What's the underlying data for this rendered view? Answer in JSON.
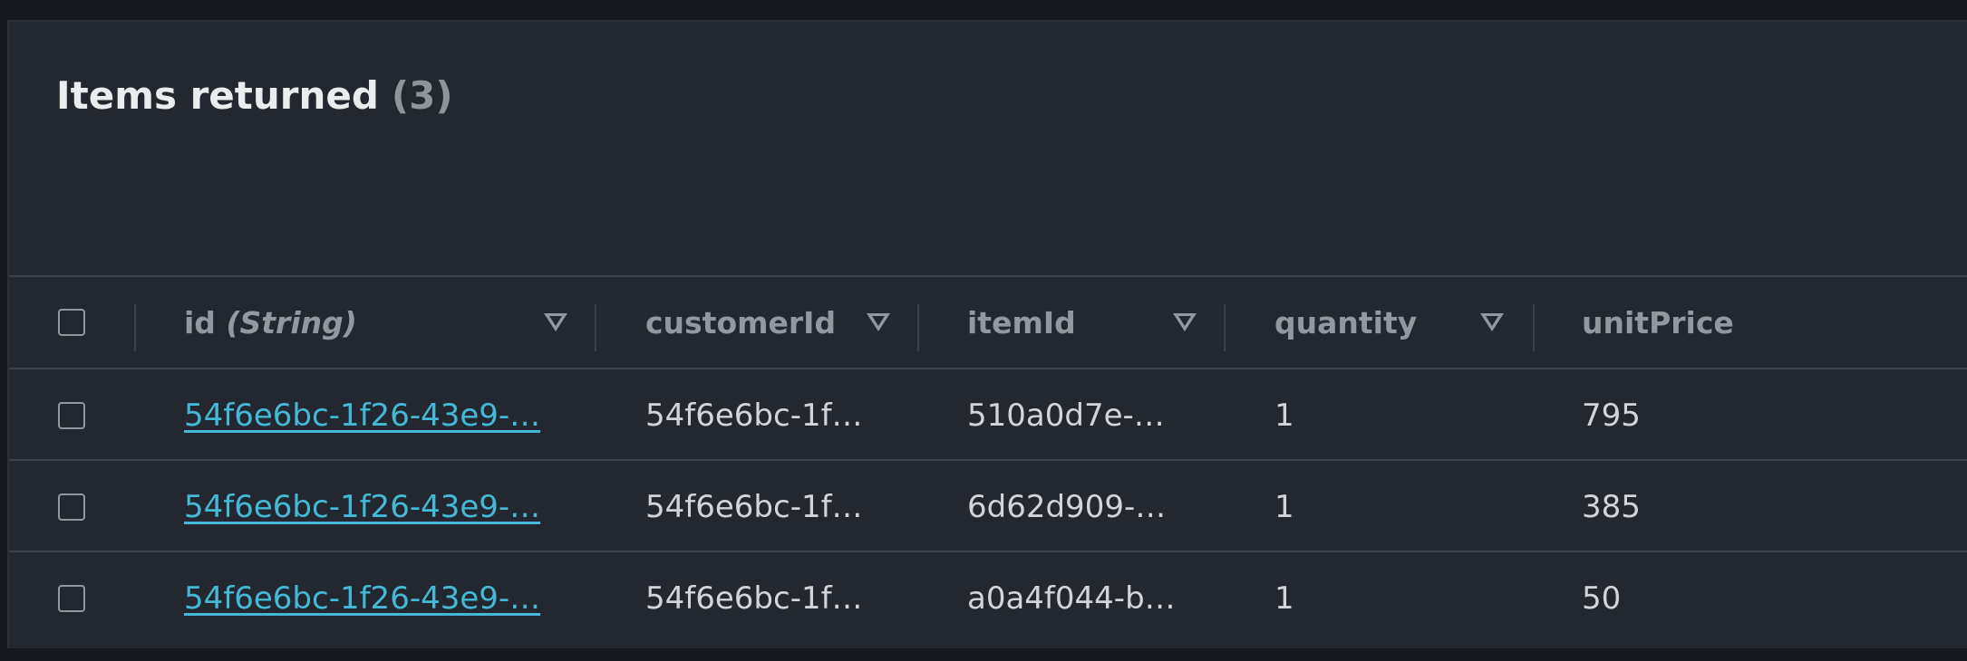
{
  "header": {
    "title": "Items returned",
    "count": "(3)"
  },
  "table": {
    "columns": [
      {
        "label": "id",
        "type_hint": "(String)"
      },
      {
        "label": "customerId"
      },
      {
        "label": "itemId"
      },
      {
        "label": "quantity"
      },
      {
        "label": "unitPrice"
      }
    ],
    "rows": [
      {
        "id": "54f6e6bc-1f26-43e9-…",
        "customerId": "54f6e6bc-1f…",
        "itemId": "510a0d7e-…",
        "quantity": "1",
        "unitPrice": "795"
      },
      {
        "id": "54f6e6bc-1f26-43e9-…",
        "customerId": "54f6e6bc-1f…",
        "itemId": "6d62d909-…",
        "quantity": "1",
        "unitPrice": "385"
      },
      {
        "id": "54f6e6bc-1f26-43e9-…",
        "customerId": "54f6e6bc-1f…",
        "itemId": "a0a4f044-b…",
        "quantity": "1",
        "unitPrice": "50"
      }
    ]
  },
  "colors": {
    "background": "#16191f",
    "panel": "#232730",
    "link": "#44b9d6",
    "header_text": "#eaeded",
    "muted": "#8f999f"
  },
  "icons": {
    "sort": "sort-triangle-down-icon"
  }
}
